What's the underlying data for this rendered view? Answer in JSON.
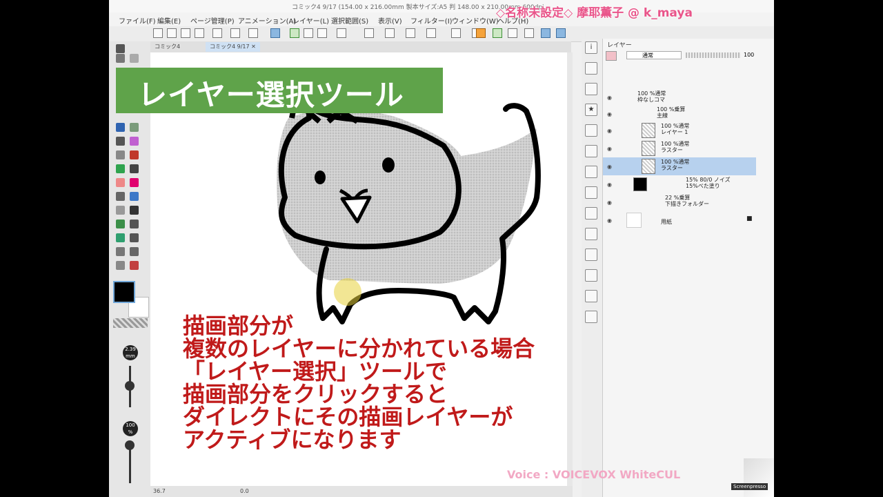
{
  "window": {
    "title": "コミック4 9/17 (154.00 x 216.00mm 製本サイズ:A5 判 148.00 x 210.00mm 600dpi"
  },
  "watermark": "◇名称未設定◇ 摩耶薫子 @ k_maya",
  "menu": [
    "ファイル(F)",
    "編集(E)",
    "ページ管理(P)",
    "アニメーション(A)",
    "レイヤー(L)",
    "選択範囲(S)",
    "表示(V)",
    "フィルター(I)",
    "ウィンドウ(W)",
    "ヘルプ(H)"
  ],
  "tabs": [
    {
      "label": "コミック4",
      "active": false
    },
    {
      "label": "コミック4",
      "suffix": "9/17",
      "active": true
    }
  ],
  "brush": {
    "size": "2.39\nmm",
    "opacity": "100\n%"
  },
  "status": {
    "zoom": "36.7",
    "angle": "0.0"
  },
  "layer_panel": {
    "tab": "レイヤー",
    "blend_mode": "通常",
    "opacity": "100",
    "layers": [
      {
        "mode": "100 %通常",
        "name": "枠なしコマ",
        "type": "folder",
        "indent": 0
      },
      {
        "mode": "100 %乗算",
        "name": "主線",
        "type": "folder",
        "indent": 1
      },
      {
        "mode": "100 %通常",
        "name": "レイヤー 1",
        "type": "raster",
        "indent": 2
      },
      {
        "mode": "100 %通常",
        "name": "ラスター",
        "type": "raster",
        "indent": 2
      },
      {
        "mode": "100 %通常",
        "name": "ラスター",
        "type": "raster",
        "indent": 2,
        "selected": true
      },
      {
        "mode": "15% 80/0 ノイズ",
        "name": "15%べた塗り",
        "type": "fill",
        "indent": 1
      },
      {
        "mode": "22 %乗算",
        "name": "下描きフォルダー",
        "type": "folder",
        "indent": 0
      },
      {
        "mode": "",
        "name": "用紙",
        "type": "paper",
        "indent": 0
      }
    ]
  },
  "banner": "レイヤー選択ツール",
  "caption": [
    "描画部分が",
    "複数のレイヤーに分かれている場合",
    "「レイヤー選択」ツールで",
    "描画部分をクリックすると",
    "ダイレクトにその描画レイヤーが",
    "アクティブになります"
  ],
  "voice": "Voice : VOICEVOX WhiteCUL",
  "screenpresso": "Screenpresso",
  "colors": {
    "banner": "#5fa34a",
    "caption": "#c01a1a",
    "watermark": "#e9558a",
    "selected_layer": "#b7d1ee"
  }
}
